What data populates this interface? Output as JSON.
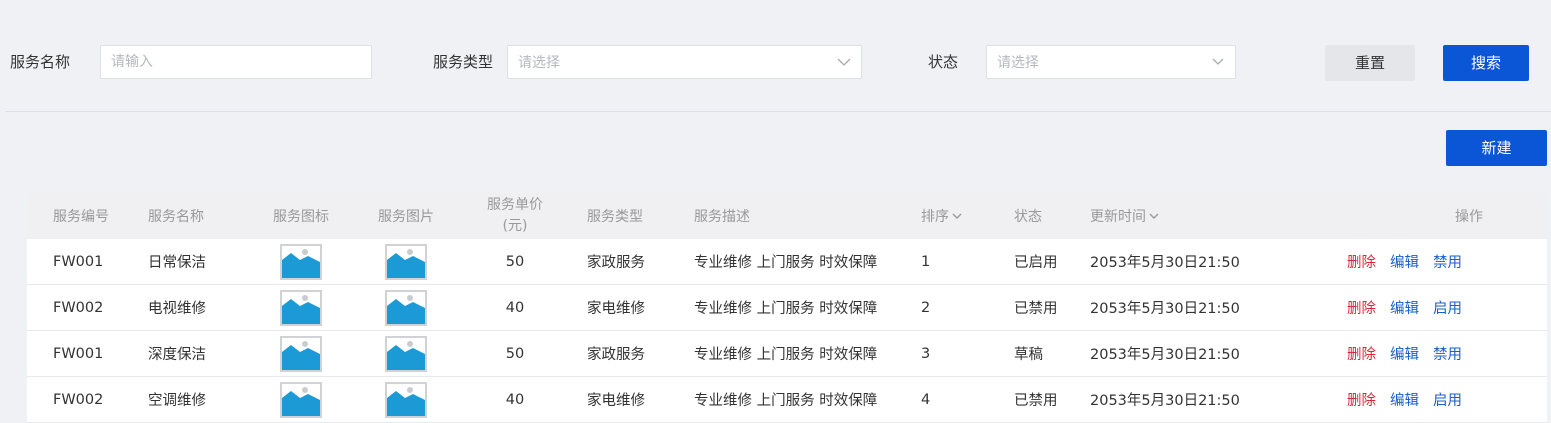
{
  "filters": {
    "name_label": "服务名称",
    "name_placeholder": "请输入",
    "type_label": "服务类型",
    "type_placeholder": "请选择",
    "status_label": "状态",
    "status_placeholder": "请选择",
    "reset_label": "重置",
    "search_label": "搜索"
  },
  "toolbar": {
    "new_label": "新建"
  },
  "table": {
    "headers": {
      "code": "服务编号",
      "name": "服务名称",
      "icon": "服务图标",
      "image": "服务图片",
      "price_line1": "服务单价",
      "price_line2": "(元)",
      "type": "服务类型",
      "desc": "服务描述",
      "sort": "排序",
      "status": "状态",
      "updated": "更新时间",
      "actions": "操作"
    },
    "rows": [
      {
        "code": "FW001",
        "name": "日常保洁",
        "price": "50",
        "type": "家政服务",
        "desc": "专业维修 上门服务 时效保障",
        "sort": "1",
        "status": "已启用",
        "updated": "2053年5月30日21:50",
        "act_delete": "删除",
        "act_edit": "编辑",
        "act_toggle": "禁用"
      },
      {
        "code": "FW002",
        "name": "电视维修",
        "price": "40",
        "type": "家电维修",
        "desc": "专业维修 上门服务 时效保障",
        "sort": "2",
        "status": "已禁用",
        "updated": "2053年5月30日21:50",
        "act_delete": "删除",
        "act_edit": "编辑",
        "act_toggle": "启用"
      },
      {
        "code": "FW001",
        "name": "深度保洁",
        "price": "50",
        "type": "家政服务",
        "desc": "专业维修 上门服务 时效保障",
        "sort": "3",
        "status": "草稿",
        "updated": "2053年5月30日21:50",
        "act_delete": "删除",
        "act_edit": "编辑",
        "act_toggle": "禁用"
      },
      {
        "code": "FW002",
        "name": "空调维修",
        "price": "40",
        "type": "家电维修",
        "desc": "专业维修 上门服务 时效保障",
        "sort": "4",
        "status": "已禁用",
        "updated": "2053年5月30日21:50",
        "act_delete": "删除",
        "act_edit": "编辑",
        "act_toggle": "启用"
      }
    ]
  },
  "colors": {
    "primary": "#0b56d6",
    "danger": "#e0243a",
    "link": "#1a5fd0",
    "image_placeholder": "#1b9ad6"
  },
  "icons": {
    "select_arrow": "chevron-down-icon",
    "sort_arrow": "chevron-down-icon",
    "thumbnail": "image-placeholder-icon"
  }
}
